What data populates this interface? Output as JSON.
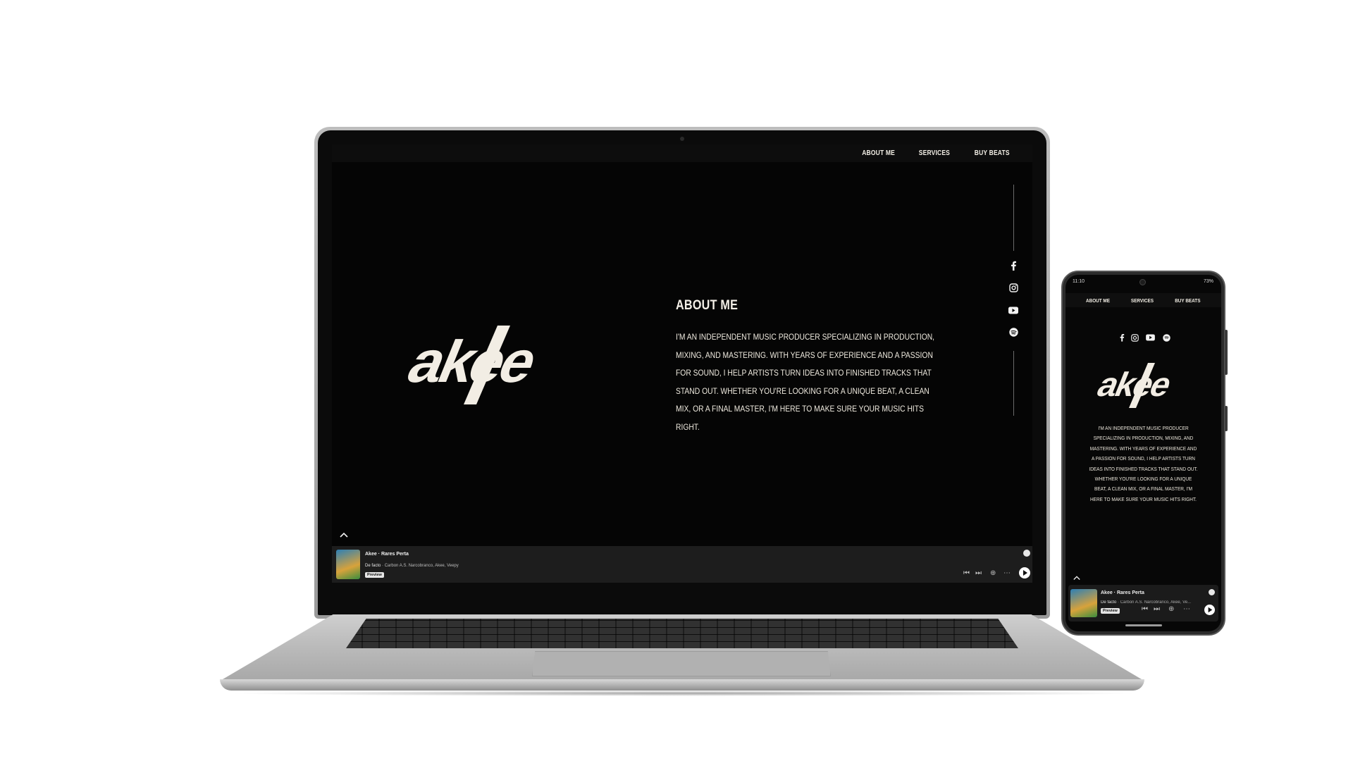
{
  "site": {
    "nav": [
      "ABOUT ME",
      "SERVICES",
      "BUY BEATS"
    ],
    "logo_text": "akee",
    "about_title": "ABOUT ME",
    "about_body": "I'M AN INDEPENDENT MUSIC PRODUCER SPECIALIZING IN PRODUCTION, MIXING, AND MASTERING. WITH YEARS OF EXPERIENCE AND A PASSION FOR SOUND, I HELP ARTISTS TURN IDEAS INTO FINISHED TRACKS THAT STAND OUT. WHETHER YOU'RE LOOKING FOR A UNIQUE BEAT, A CLEAN MIX, OR A FINAL MASTER, I'M HERE TO MAKE SURE YOUR MUSIC HITS RIGHT.",
    "social_icons": [
      "facebook-icon",
      "instagram-icon",
      "youtube-icon",
      "spotify-icon"
    ]
  },
  "player": {
    "title_line": "Akee · Rares Perta",
    "track_title": "De facto",
    "track_artists": "Carbon A.S. Narcobranco, Akee, Veepy",
    "track_artists_mobile": "Carbon A.S. Narcobranco, Akee, Ve...",
    "preview_badge": "Preview"
  },
  "phone_status": {
    "time": "11:10",
    "battery": "73%"
  },
  "colors": {
    "background": "#ffffff",
    "site_bg": "#050505",
    "text": "#f3efe6",
    "player_bg": "#1d1d1d"
  }
}
